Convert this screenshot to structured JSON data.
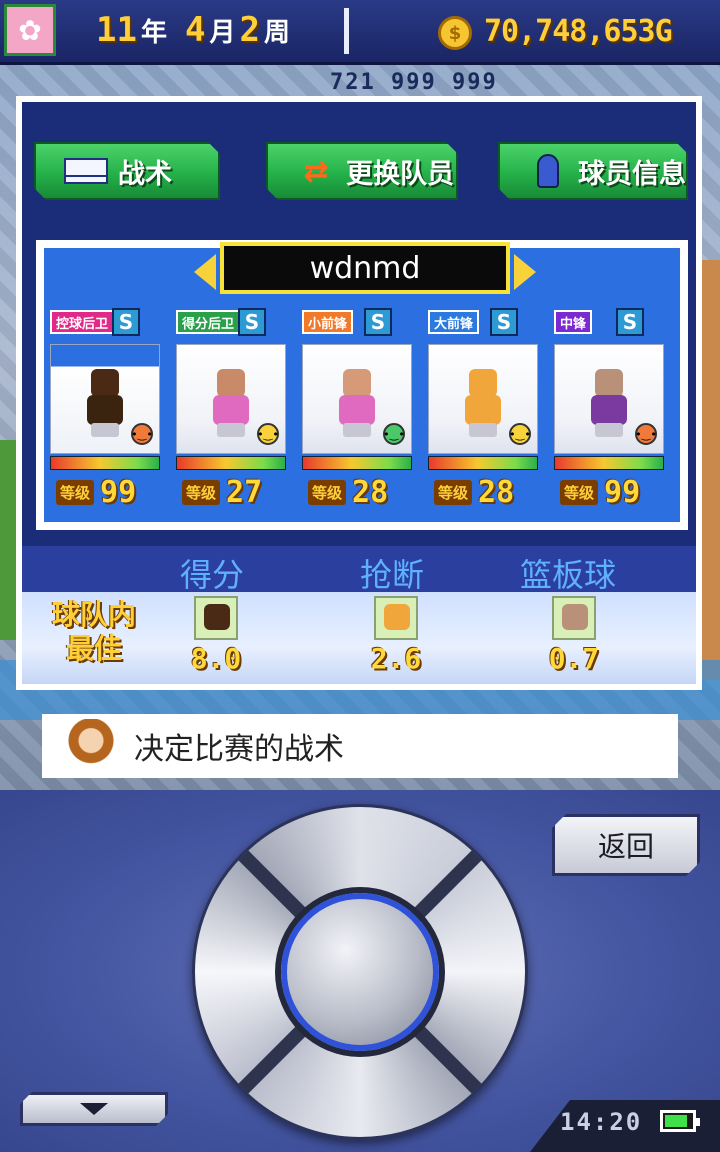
{
  "topbar": {
    "year_num": "11",
    "year_unit": "年",
    "month_num": "4",
    "month_unit": "月",
    "week_num": "2",
    "week_unit": "周",
    "money": "70,748,653G",
    "world_stats": "721 999 999"
  },
  "tabs": [
    {
      "label": "战术",
      "icon": "tactics-board-icon"
    },
    {
      "label": "更换队员",
      "icon": "swap-icon"
    },
    {
      "label": "球员信息",
      "icon": "player-info-icon"
    }
  ],
  "team": {
    "name": "wdnmd",
    "players": [
      {
        "position": "控球后卫",
        "pos_color": "#e02a8a",
        "rank": "S",
        "level_label": "等级",
        "level": "99",
        "head": "#4a2a14",
        "body": "#3a2410",
        "face_color": "#f07a3a"
      },
      {
        "position": "得分后卫",
        "pos_color": "#2aa04a",
        "rank": "S",
        "level_label": "等级",
        "level": "27",
        "head": "#c98a6a",
        "body": "#e06ac0",
        "face_color": "#f7d23a"
      },
      {
        "position": "小前锋",
        "pos_color": "#f07a2a",
        "rank": "S",
        "level_label": "等级",
        "level": "28",
        "head": "#d79a78",
        "body": "#e06ac0",
        "face_color": "#4ac86a"
      },
      {
        "position": "大前锋",
        "pos_color": "#2a7ae0",
        "rank": "S",
        "level_label": "等级",
        "level": "28",
        "head": "#f0a63a",
        "body": "#f0a63a",
        "face_color": "#f7d23a"
      },
      {
        "position": "中锋",
        "pos_color": "#7a2ad0",
        "rank": "S",
        "level_label": "等级",
        "level": "99",
        "head": "#b99078",
        "body": "#7a3aa0",
        "face_color": "#f07a3a"
      }
    ]
  },
  "stats": {
    "headers": [
      "得分",
      "抢断",
      "篮板球"
    ],
    "best_title": "球队内最佳",
    "best": [
      {
        "value": "8.0",
        "head": "#4a2a14"
      },
      {
        "value": "2.6",
        "head": "#f0a63a"
      },
      {
        "value": "0.7",
        "head": "#b99078"
      }
    ]
  },
  "message": "决定比赛的战术",
  "controls": {
    "back_label": "返回",
    "clock": "14:20"
  }
}
